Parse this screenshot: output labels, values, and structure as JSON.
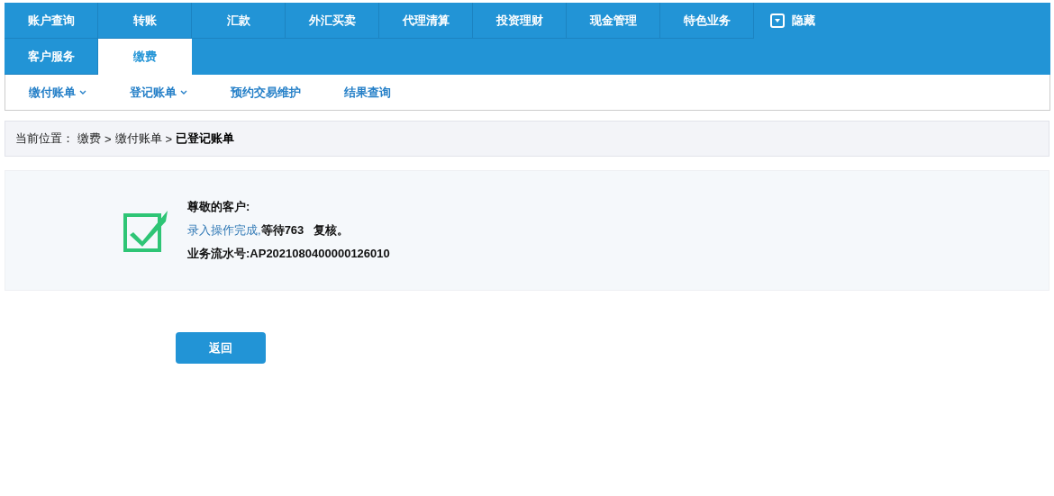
{
  "nav": {
    "tab_rows": [
      {
        "tabs": [
          {
            "label": "账户查询",
            "selected": false
          },
          {
            "label": "转账",
            "selected": false
          },
          {
            "label": "汇款",
            "selected": false
          },
          {
            "label": "外汇买卖",
            "selected": false
          },
          {
            "label": "代理清算",
            "selected": false
          },
          {
            "label": "投资理财",
            "selected": false
          },
          {
            "label": "现金管理",
            "selected": false
          },
          {
            "label": "特色业务",
            "selected": false
          }
        ]
      },
      {
        "tabs": [
          {
            "label": "客户服务",
            "selected": false
          },
          {
            "label": "缴费",
            "selected": true
          }
        ]
      }
    ],
    "hide_toggle": {
      "label": "隐藏"
    },
    "sub_items": [
      {
        "label": "缴付账单",
        "dropdown": true
      },
      {
        "label": "登记账单",
        "dropdown": true
      },
      {
        "label": "预约交易维护",
        "dropdown": false
      },
      {
        "label": "结果查询",
        "dropdown": false
      }
    ]
  },
  "breadcrumb": [
    {
      "kind": "label",
      "text": "当前位置："
    },
    {
      "kind": "link",
      "text": "缴费"
    },
    {
      "kind": "separator",
      "text": ">"
    },
    {
      "kind": "link",
      "text": "缴付账单"
    },
    {
      "kind": "separator",
      "text": ">"
    },
    {
      "kind": "current",
      "text": "已登记账单"
    }
  ],
  "message": {
    "greeting": "尊敬的客户:",
    "status": "录入操作完成,",
    "waiting": "等待763   复核。",
    "serial": "业务流水号:AP2021080400000126010"
  },
  "buttons": [
    {
      "label": "返回"
    }
  ]
}
